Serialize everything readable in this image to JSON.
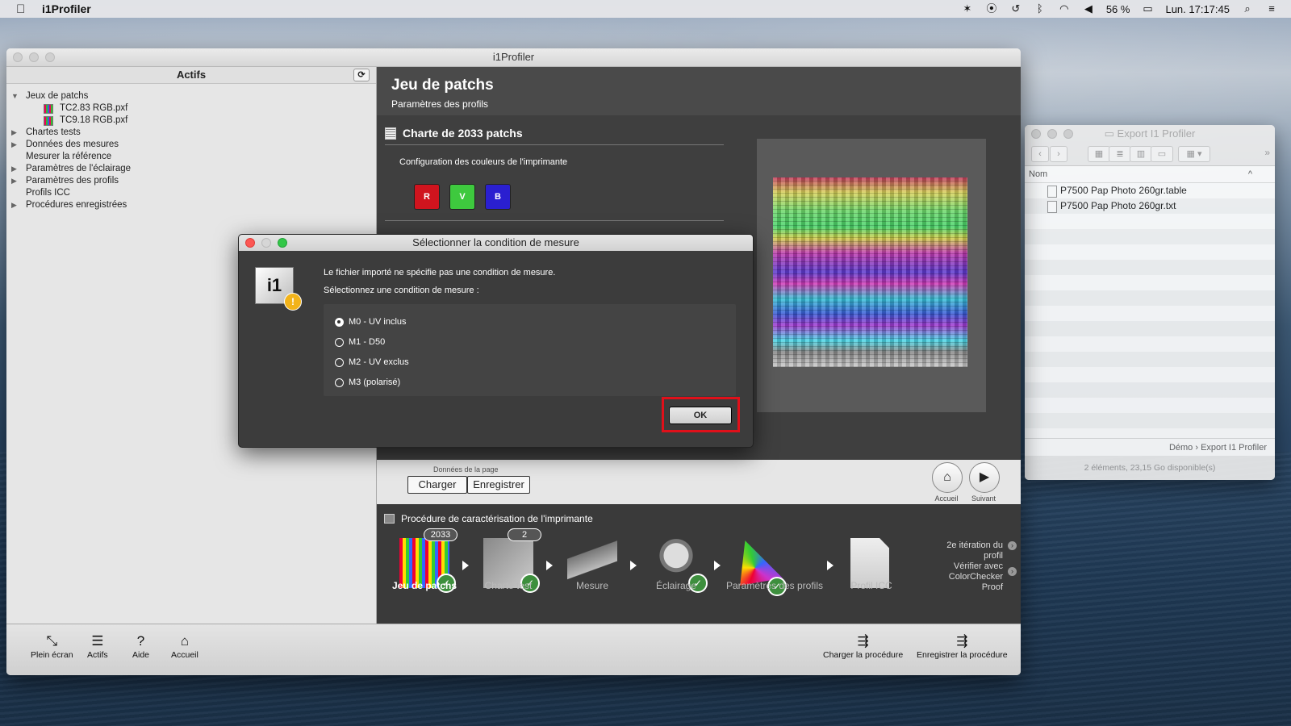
{
  "menubar": {
    "app_name": "i1Profiler",
    "battery": "56 %",
    "clock": "Lun. 17:17:45"
  },
  "main_window": {
    "title": "i1Profiler",
    "sidebar": {
      "title": "Actifs",
      "tree": [
        {
          "label": "Jeux de patchs",
          "expanded": true,
          "children": [
            "TC2.83 RGB.pxf",
            "TC9.18 RGB.pxf"
          ]
        },
        {
          "label": "Chartes tests",
          "expandable": true
        },
        {
          "label": "Données des mesures",
          "expandable": true
        },
        {
          "label": "Mesurer la référence",
          "expandable": false
        },
        {
          "label": "Paramètres de l'éclairage",
          "expandable": true
        },
        {
          "label": "Paramètres des profils",
          "expandable": true
        },
        {
          "label": "Profils ICC",
          "expandable": false
        },
        {
          "label": "Procédures enregistrées",
          "expandable": true
        }
      ]
    },
    "content": {
      "title": "Jeu de patchs",
      "subtitle": "Paramètres des profils",
      "chart_title": "Charte de 2033 patchs",
      "config_label": "Configuration des couleurs de l'imprimante",
      "channels": [
        {
          "label": "R",
          "color": "#d0141e"
        },
        {
          "label": "V",
          "color": "#3ec93e"
        },
        {
          "label": "B",
          "color": "#2a1fd0"
        }
      ]
    },
    "page_data": {
      "label": "Données de la page",
      "load": "Charger",
      "save": "Enregistrer",
      "home": "Accueil",
      "next": "Suivant"
    },
    "workflow": {
      "title": "Procédure de caractérisation de l'imprimante",
      "steps": [
        {
          "label": "Jeu de patchs",
          "badge": "2033",
          "done": true,
          "active": true
        },
        {
          "label": "Charte test",
          "badge": "2",
          "done": true
        },
        {
          "label": "Mesure",
          "done": false
        },
        {
          "label": "Éclairage",
          "done": true
        },
        {
          "label": "Paramètres des profils",
          "done": true
        },
        {
          "label": "Profil ICC",
          "done": false
        }
      ],
      "iteration": "2e itération du profil",
      "verify": "Vérifier avec ColorChecker Proof"
    },
    "toolbar": {
      "fullscreen": "Plein écran",
      "assets": "Actifs",
      "help": "Aide",
      "home": "Accueil",
      "load_procedure": "Charger la procédure",
      "save_procedure": "Enregistrer la procédure"
    }
  },
  "dialog": {
    "title": "Sélectionner la condition de mesure",
    "message1": "Le fichier importé ne spécifie pas une condition de mesure.",
    "message2": "Sélectionnez une condition de mesure :",
    "options": [
      {
        "label": "M0 - UV inclus",
        "selected": true
      },
      {
        "label": "M1 - D50",
        "selected": false
      },
      {
        "label": "M2 - UV exclus",
        "selected": false
      },
      {
        "label": "M3 (polarisé)",
        "selected": false
      }
    ],
    "ok": "OK",
    "highlight_color": "#e0101a"
  },
  "finder": {
    "title": "Export I1 Profiler",
    "column": "Nom",
    "files": [
      "P7500 Pap Photo 260gr.table",
      "P7500 Pap Photo 260gr.txt"
    ],
    "path": [
      "Démo",
      "Export I1 Profiler"
    ],
    "status": "2 éléments, 23,15 Go disponible(s)"
  }
}
